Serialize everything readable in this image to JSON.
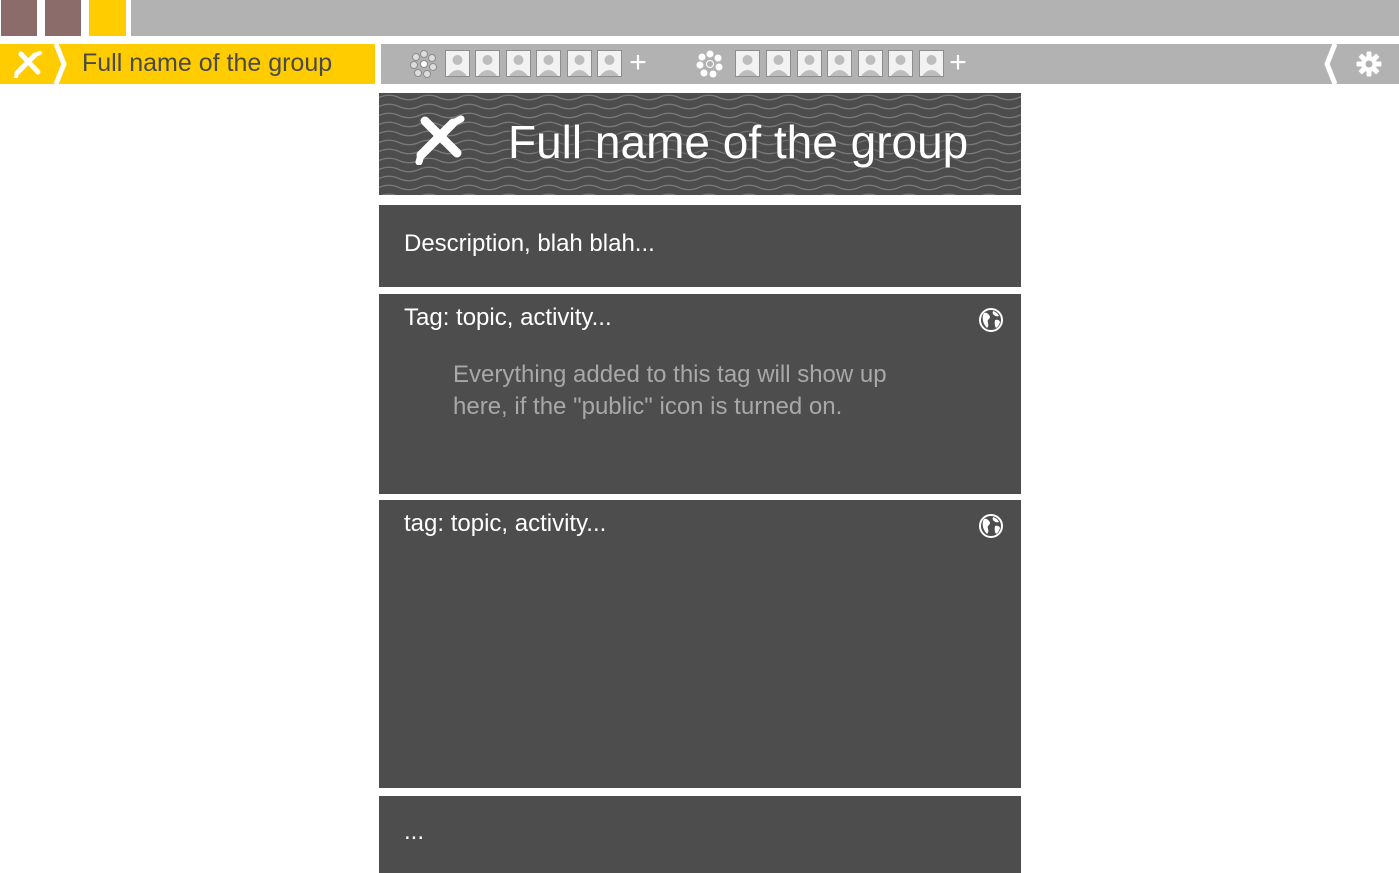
{
  "top_tiles": {
    "colors": [
      "#8c6b6b",
      "#8c6b6b",
      "#ffcc00"
    ]
  },
  "colors": {
    "accent": "#ffcc00",
    "bar": "#b2b2b2",
    "panel": "#4d4d4d",
    "hint_text": "#a8a8a8"
  },
  "nav": {
    "group_name": "Full name of the group",
    "group_logo_icon": "group-logo-icon",
    "member_groups": [
      {
        "icon": "member-cluster-light-icon",
        "avatar_count": 6,
        "add_label": "+"
      },
      {
        "icon": "member-cluster-icon",
        "avatar_count": 7,
        "add_label": "+"
      }
    ],
    "settings_icon": "gear-icon"
  },
  "hero": {
    "title": "Full name of the group",
    "logo_icon": "group-logo-icon"
  },
  "description": {
    "text": "Description, blah blah..."
  },
  "tags": [
    {
      "title": "Tag: topic, activity...",
      "icon": "globe-icon",
      "hint_lines": [
        "Everything added to this tag will show up",
        "here, if the \"public\" icon is turned on."
      ]
    },
    {
      "title": "tag: topic, activity...",
      "icon": "globe-icon"
    }
  ],
  "more": {
    "text": "..."
  }
}
